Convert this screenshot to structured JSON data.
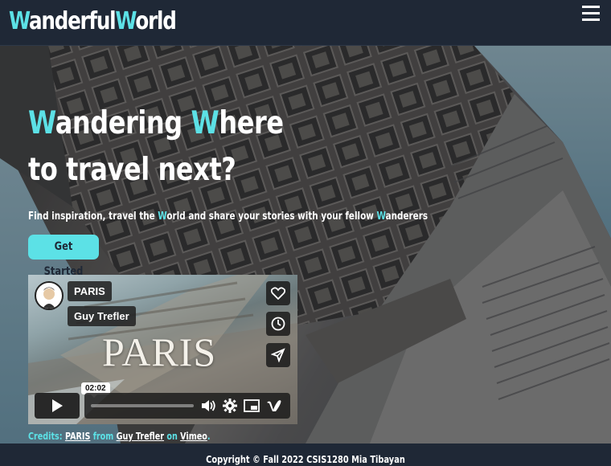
{
  "header": {
    "logo_w1": "W",
    "logo_rest1": "anderful",
    "logo_w2": "W",
    "logo_rest2": "orld",
    "menu_icon": "hamburger-icon"
  },
  "hero": {
    "headline_w1": "W",
    "headline_part1": "andering ",
    "headline_w2": "W",
    "headline_part2": "here",
    "headline_line2": "to travel next?",
    "subline_part1": "Find inspiration, travel the ",
    "subline_w1": "W",
    "subline_part2": "orld and share your stories with your fellow ",
    "subline_w2": "W",
    "subline_part3": "anderers",
    "cta_label": "Get Started",
    "background_image": "arc-de-triomphe-photo"
  },
  "video": {
    "title": "PARIS",
    "author": "Guy Trefler",
    "overlay_title": "PARIS",
    "time": "02:02",
    "progress": 0.0,
    "icons": [
      "heart-icon",
      "clock-icon",
      "send-icon",
      "play-icon",
      "volume-icon",
      "settings-icon",
      "pip-icon",
      "vimeo-logo-icon"
    ]
  },
  "credits": {
    "prefix": "Credits: ",
    "video_link": "PARIS",
    "from": " from ",
    "author_link": "Guy Trefler",
    "on": " on ",
    "platform_link": "Vimeo",
    "suffix": "."
  },
  "footer": {
    "copyright": "Copyright © Fall 2022 CSIS1280 Mia Tibayan"
  },
  "colors": {
    "accent": "#5ce1e6",
    "navbar": "#1f2836",
    "text": "#ffffff"
  }
}
